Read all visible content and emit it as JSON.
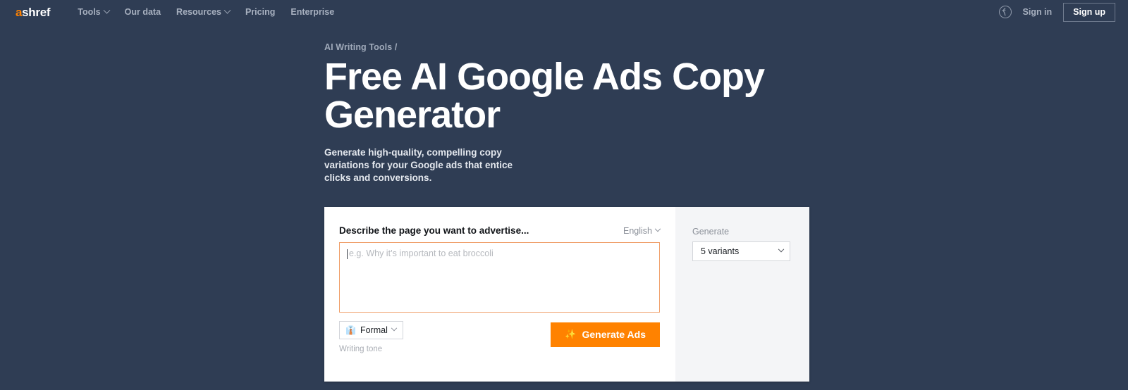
{
  "brand": {
    "logo_first": "a",
    "logo_rest": "shref",
    "accent_color": "#ff8200",
    "background_color": "#2f3d54"
  },
  "header": {
    "nav_items": [
      {
        "label": "Tools",
        "has_caret": true
      },
      {
        "label": "Our data",
        "has_caret": false
      },
      {
        "label": "Resources",
        "has_caret": true
      },
      {
        "label": "Pricing",
        "has_caret": false
      },
      {
        "label": "Enterprise",
        "has_caret": false
      }
    ],
    "language_icon": "globe-icon",
    "sign_in_label": "Sign in",
    "sign_up_label": "Sign up"
  },
  "hero": {
    "breadcrumb": "AI Writing Tools /",
    "title": "Free AI Google Ads Copy Generator",
    "subtitle": "Generate high-quality, compelling copy variations for your Google ads that entice clicks and conversions."
  },
  "form": {
    "field_label": "Describe the page you want to advertise...",
    "language_value": "English",
    "textarea_value": "",
    "textarea_placeholder": "e.g. Why it’s important to eat broccoli",
    "tone_emoji": "👔",
    "tone_value": "Formal",
    "tone_caption": "Writing tone",
    "submit_icon": "✨",
    "submit_label": "Generate Ads"
  },
  "sidebar": {
    "generate_label": "Generate",
    "variants_value": "5 variants"
  }
}
